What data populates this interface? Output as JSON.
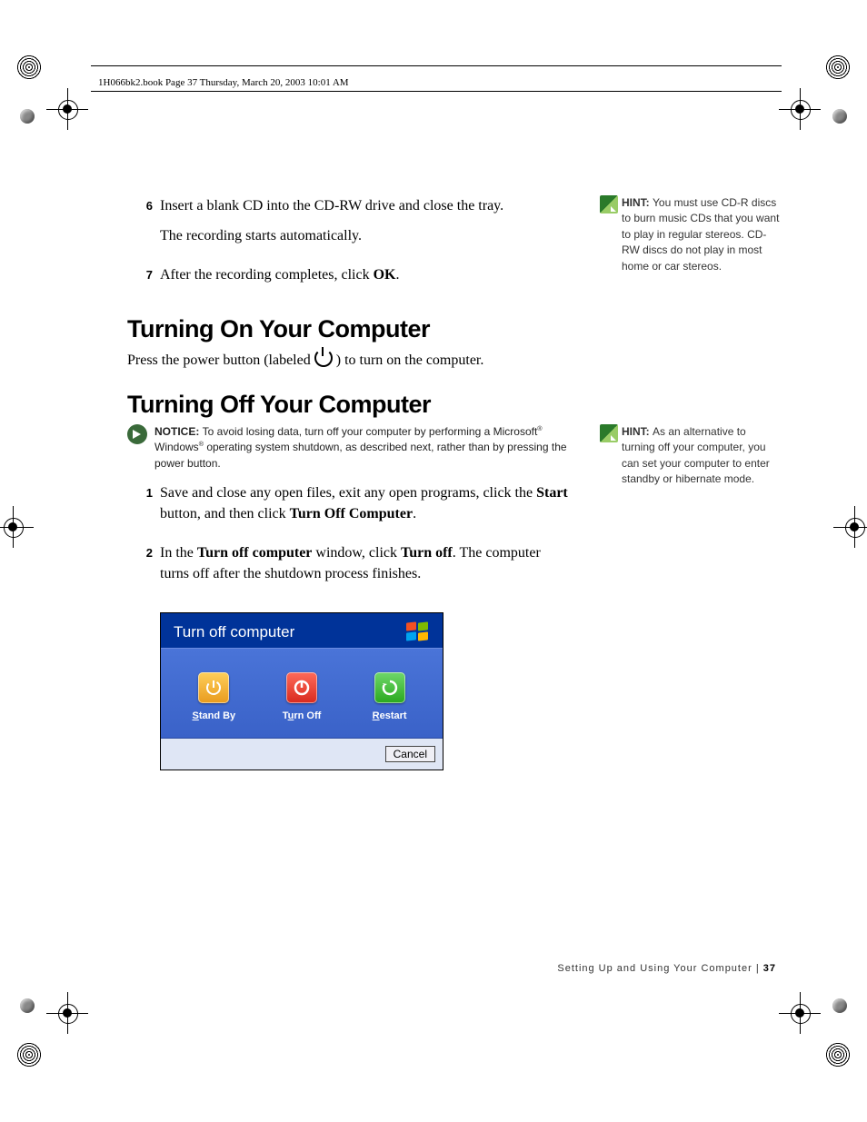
{
  "header_line": "1H066bk2.book  Page 37  Thursday, March 20, 2003  10:01 AM",
  "steps_top": [
    {
      "num": "6",
      "para1": "Insert a blank CD into the CD-RW drive and close the tray.",
      "para2": "The recording starts automatically."
    },
    {
      "num": "7",
      "para1_a": "After the recording completes, click ",
      "para1_b": "OK",
      "para1_c": "."
    }
  ],
  "heading1": "Turning On Your Computer",
  "turning_on_a": "Press the power button (labeled  ",
  "turning_on_b": " ) to turn on the computer.",
  "heading2": "Turning Off Your Computer",
  "notice": {
    "label": "NOTICE: ",
    "text_a": "To avoid losing data, turn off your computer by performing a Microsoft",
    "reg1": "®",
    "text_b": " Windows",
    "reg2": "®",
    "text_c": " operating system shutdown, as described next, rather than by pressing the power button."
  },
  "steps_off": [
    {
      "num": "1",
      "parts": [
        "Save and close any open files, exit any open programs, click the ",
        "Start",
        " button, and then click ",
        "Turn Off Computer",
        "."
      ]
    },
    {
      "num": "2",
      "parts": [
        "In the ",
        "Turn off computer",
        " window, click ",
        "Turn off",
        ". The computer turns off after the shutdown process finishes."
      ]
    }
  ],
  "dialog": {
    "title": "Turn off computer",
    "standby_a": "S",
    "standby_b": "tand By",
    "turnoff_a": "T",
    "turnoff_b": "u",
    "turnoff_c": "rn Off",
    "restart_a": "R",
    "restart_b": "estart",
    "cancel": "Cancel"
  },
  "hints": [
    {
      "label": "HINT: ",
      "text": "You must use CD-R discs to burn music CDs that you want to play in regular stereos. CD-RW discs do not play in most home or car stereos."
    },
    {
      "label": "HINT: ",
      "text": "As an alternative to turning off your computer, you can set your computer to enter standby or hibernate mode."
    }
  ],
  "footer": {
    "section": "Setting Up and Using Your Computer",
    "sep": "  |  ",
    "page": "37"
  }
}
